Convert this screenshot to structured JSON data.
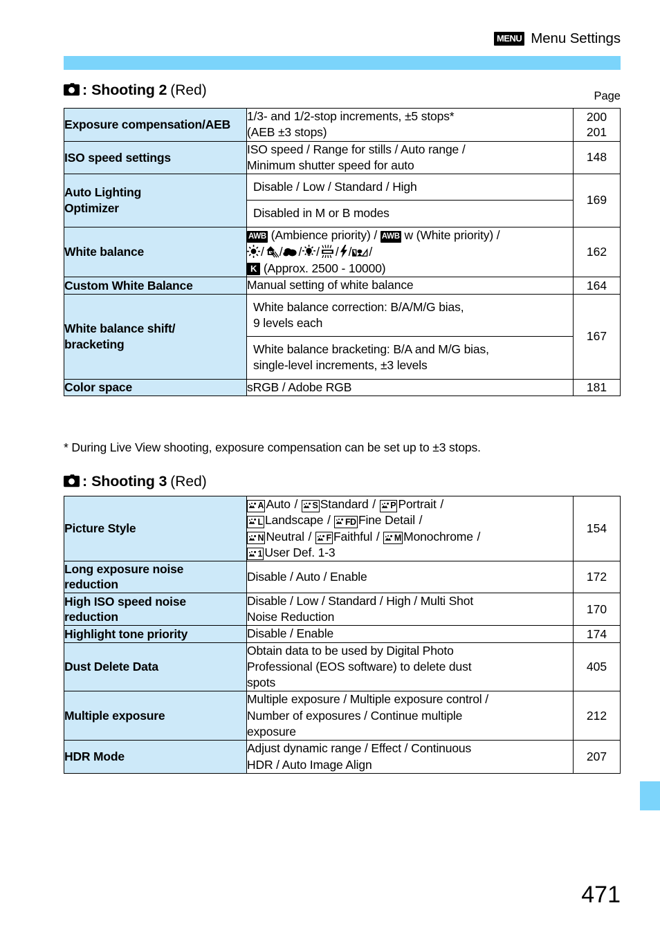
{
  "running_head": {
    "badge": "MENU",
    "title": "Menu Settings"
  },
  "colors": {
    "rule_blue": "#7bd4fb",
    "row_label_blue": "#cde9f9",
    "side_tab_blue": "#7bd4fb"
  },
  "sections": [
    {
      "icon": "camera-icon",
      "colon": ":",
      "title": "Shooting 2",
      "color_note": "(Red)",
      "page_column_label": "Page",
      "rows": [
        {
          "name": "Exposure compensation/AEB",
          "desc_lines": [
            "1/3- and 1/2-stop increments, ±5 stops*",
            "(AEB ±3 stops)"
          ],
          "page": "200\n201"
        },
        {
          "name": "ISO speed settings",
          "desc_lines": [
            "ISO speed / Range for stills / Auto range /",
            "Minimum shutter speed for auto"
          ],
          "page": "148"
        },
        {
          "name": "Auto Lighting Optimizer",
          "sub_rows": [
            "Disable / Low / Standard / High",
            "Disabled in M or B modes"
          ],
          "page": "169"
        },
        {
          "name": "White balance",
          "wb_line1_pre": "",
          "wb_line1_a": "(Ambience priority) /",
          "wb_line1_b": "w (White priority) /",
          "wb_line3": "(Approx. 2500 - 10000)",
          "page": "162"
        },
        {
          "name": "Custom White Balance",
          "desc_lines": [
            "Manual setting of white balance"
          ],
          "page": "164"
        },
        {
          "name": "White balance shift/ bracketing",
          "sub_rows_multi": [
            [
              "White balance correction: B/A/M/G bias,",
              "9 levels each"
            ],
            [
              "White balance bracketing: B/A and M/G bias,",
              "single-level increments, ±3 levels"
            ]
          ],
          "page": "167"
        },
        {
          "name": "Color space",
          "desc_lines": [
            "sRGB / Adobe RGB"
          ],
          "page": "181"
        }
      ],
      "footnote": "* During Live View shooting, exposure compensation can be set up to ±3 stops."
    },
    {
      "icon": "camera-icon",
      "colon": ":",
      "title": "Shooting 3",
      "color_note": "(Red)",
      "rows": [
        {
          "name": "Picture Style",
          "picture_style": {
            "line1": [
              {
                "letter": "A",
                "label": "Auto",
                "sep": "/"
              },
              {
                "letter": "S",
                "label": "Standard",
                "sep": "/"
              },
              {
                "letter": "P",
                "label": "Portrait",
                "sep": "/"
              }
            ],
            "line2": [
              {
                "letter": "L",
                "label": "Landscape",
                "sep": "/"
              },
              {
                "letter": "FD",
                "label": "Fine Detail",
                "sep": "/"
              }
            ],
            "line3": [
              {
                "letter": "N",
                "label": "Neutral",
                "sep": "/"
              },
              {
                "letter": "F",
                "label": "Faithful",
                "sep": "/"
              },
              {
                "letter": "M",
                "label": "Monochrome",
                "sep": "/"
              }
            ],
            "line4": [
              {
                "letter": "1",
                "label": "User Def. 1-3",
                "sep": ""
              }
            ]
          },
          "page": "154"
        },
        {
          "name": "Long exposure noise reduction",
          "desc_lines": [
            "Disable / Auto / Enable"
          ],
          "page": "172"
        },
        {
          "name": "High ISO speed noise reduction",
          "desc_lines": [
            "Disable / Low / Standard / High / Multi Shot",
            "Noise Reduction"
          ],
          "page": "170"
        },
        {
          "name": "Highlight tone priority",
          "desc_lines": [
            "Disable / Enable"
          ],
          "page": "174"
        },
        {
          "name": "Dust Delete Data",
          "desc_lines": [
            "Obtain data to be used by Digital Photo",
            "Professional (EOS software) to delete dust",
            "spots"
          ],
          "page": "405"
        },
        {
          "name": "Multiple exposure",
          "desc_lines": [
            "Multiple exposure / Multiple exposure control /",
            "Number of exposures / Continue multiple",
            "exposure"
          ],
          "page": "212"
        },
        {
          "name": "HDR Mode",
          "desc_lines": [
            "Adjust dynamic range / Effect / Continuous",
            "HDR / Auto Image Align"
          ],
          "page": "207"
        }
      ]
    }
  ],
  "white_balance_icons": {
    "awb_badge": "AWB",
    "k_badge": "K",
    "icon_names": [
      "awb-icon",
      "awb-white-priority-icon",
      "daylight-icon",
      "shade-icon",
      "cloudy-icon",
      "tungsten-icon",
      "fluorescent-icon",
      "flash-icon",
      "custom-wb-icon",
      "kelvin-icon"
    ]
  },
  "folio": "471"
}
